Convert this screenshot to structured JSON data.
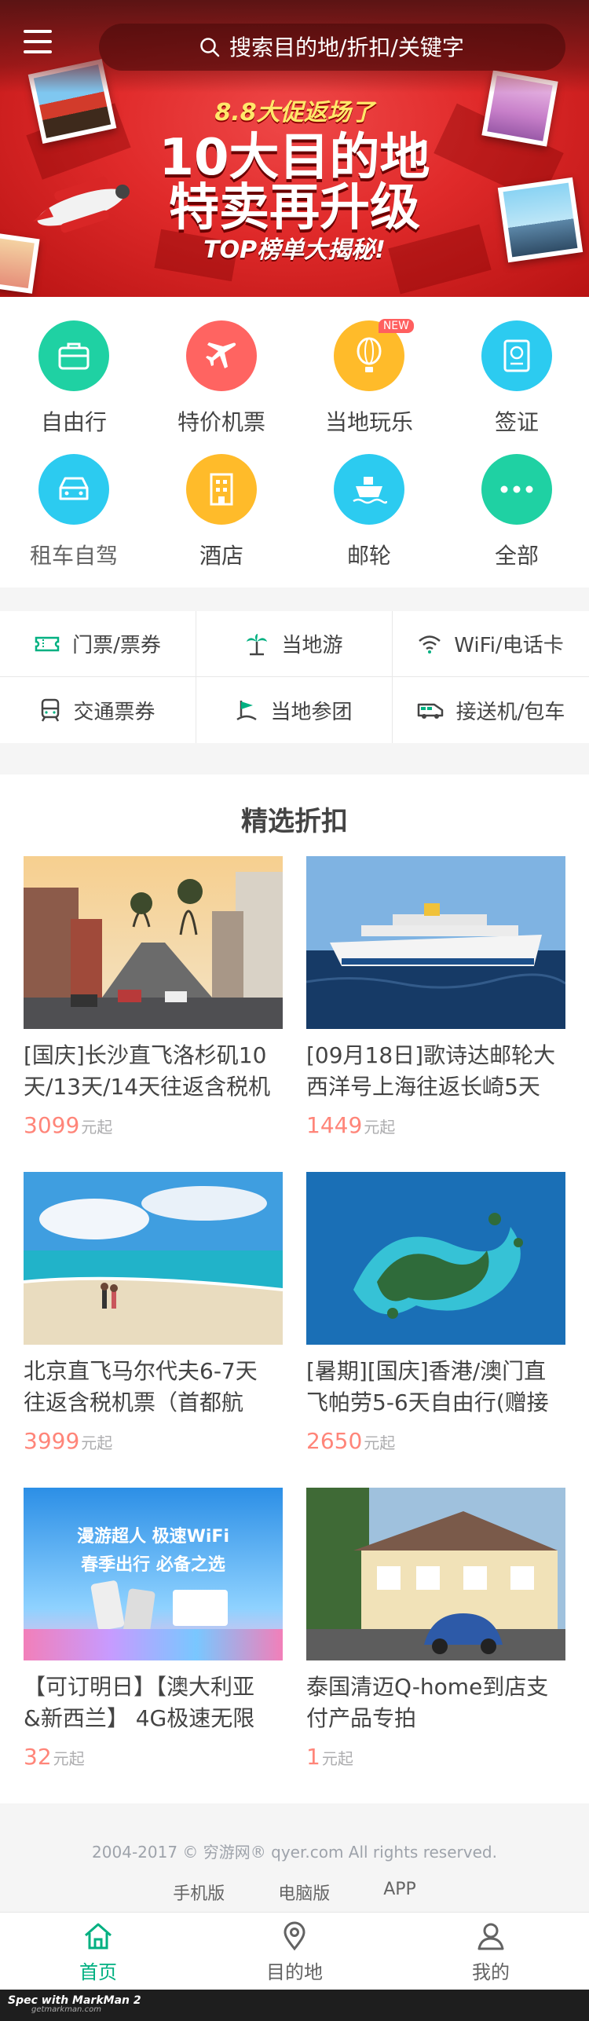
{
  "header": {
    "search_placeholder": "搜索目的地/折扣/关键字"
  },
  "banner": {
    "subtitle": "8.8大促返场了",
    "title_line1": "10大目的地",
    "title_line2": "特卖再升级",
    "tagline": "TOP榜单大揭秘!"
  },
  "categories": [
    {
      "label": "自由行",
      "icon": "suitcase-icon",
      "color": "#1fd1a3"
    },
    {
      "label": "特价机票",
      "icon": "plane-icon",
      "color": "#ff6461"
    },
    {
      "label": "当地玩乐",
      "icon": "balloon-icon",
      "color": "#ffbb2a",
      "badge": "NEW"
    },
    {
      "label": "签证",
      "icon": "passport-icon",
      "color": "#2ccbf0"
    },
    {
      "label": "租车自驾",
      "icon": "car-icon",
      "color": "#2ccbf0"
    },
    {
      "label": "酒店",
      "icon": "hotel-icon",
      "color": "#ffbb2a"
    },
    {
      "label": "邮轮",
      "icon": "ship-icon",
      "color": "#2ccbf0"
    },
    {
      "label": "全部",
      "icon": "more-icon",
      "color": "#1fd1a3"
    }
  ],
  "links": [
    {
      "label": "门票/票券",
      "icon": "ticket-icon"
    },
    {
      "label": "当地游",
      "icon": "palm-icon"
    },
    {
      "label": "WiFi/电话卡",
      "icon": "wifi-icon"
    },
    {
      "label": "交通票券",
      "icon": "train-icon"
    },
    {
      "label": "当地参团",
      "icon": "flag-icon"
    },
    {
      "label": "接送机/包车",
      "icon": "van-icon"
    }
  ],
  "deals": {
    "title": "精选折扣",
    "items": [
      {
        "line1": "[国庆]长沙直飞洛杉矶10",
        "line2": "天/13天/14天往返含税机",
        "price": "3099",
        "unit": "元起"
      },
      {
        "line1": "[09月18日]歌诗达邮轮大",
        "line2": "西洋号上海往返长崎5天",
        "price": "1449",
        "unit": "元起"
      },
      {
        "line1": "北京直飞马尔代夫6-7天",
        "line2": "往返含税机票（首都航",
        "price": "3999",
        "unit": "元起"
      },
      {
        "line1": "[暑期][国庆]香港/澳门直",
        "line2": "飞帕劳5-6天自由行(赠接",
        "price": "2650",
        "unit": "元起"
      },
      {
        "line1": "【可订明日】【澳大利亚",
        "line2": "&新西兰】 4G极速无限",
        "price": "32",
        "unit": "元起"
      },
      {
        "line1": "泰国清迈Q-home到店支",
        "line2": "付产品专拍",
        "price": "1",
        "unit": "元起"
      }
    ]
  },
  "promo_image": {
    "line1": "漫游超人  极速WiFi",
    "line2": "春季出行  必备之选"
  },
  "footer": {
    "copyright": "2004-2017 © 穷游网® qyer.com All rights reserved.",
    "links": [
      "手机版",
      "电脑版",
      "APP"
    ]
  },
  "tabbar": [
    {
      "label": "首页",
      "icon": "home-icon",
      "active": true
    },
    {
      "label": "目的地",
      "icon": "location-icon",
      "active": false
    },
    {
      "label": "我的",
      "icon": "user-icon",
      "active": false
    }
  ],
  "watermark": {
    "brand": "Spec with MarkMan 2",
    "site": "getmarkman.com"
  },
  "colors": {
    "accent": "#00b081",
    "price": "#ff8579",
    "price_unit": "#adadaf",
    "text": "#444444",
    "category_label": "#646464",
    "footer_bg": "#f5f5f5",
    "copyright": "#9ea3ab",
    "footer_link": "#656565",
    "tab_inactive": "#636363",
    "tab_border": "#e6e6e6",
    "banner_red": "#e02a2a"
  }
}
